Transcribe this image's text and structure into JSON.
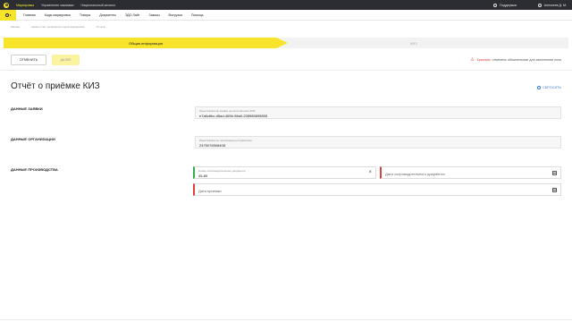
{
  "topbar": {
    "links": [
      "Маркировка",
      "Управление заказами",
      "Национальный каталог"
    ],
    "support": "Поддержка",
    "user": "Алексеев Д. М."
  },
  "subnav": {
    "items": [
      "Главная",
      "Коды маркировки",
      "Товары",
      "Документы",
      "ЭДО Лайт",
      "Заказы",
      "Выгрузки",
      "Помощь"
    ]
  },
  "breadcrumbs": [
    "Заказы",
    "Заказ-отчёт на эмиссию кодов маркировки",
    "Отчёты"
  ],
  "stepper": {
    "step1": "Общая информация",
    "step2": "КИЗ"
  },
  "actions": {
    "cancel": "ОТМЕНИТЬ",
    "next": "ДАЛЕЕ"
  },
  "required_note": {
    "red_word": "Красным",
    "text": "отмечены обязательные для заполнения поля"
  },
  "page": {
    "title": "Отчёт о приёмке КИЗ",
    "reset": "СБРОСИТЬ"
  },
  "sections": {
    "order": {
      "label": "ДАННЫЕ ЗАЯВКИ",
      "field_label": "Идентификатор заявки на изготовление КИЗ",
      "field_value": "e7a6c6bc-d5ad-465b-98a0-208985695855"
    },
    "organization": {
      "label": "ДАННЫЕ ОРГАНИЗАЦИИ",
      "field_label": "Идентификатор организации-отправителя",
      "field_value": "2475076508408"
    },
    "production": {
      "label": "ДАННЫЕ ПРОИЗВОДСТВА",
      "doc_number_label": "Номер сопроводительного документа",
      "doc_number_value": "45-89",
      "doc_date_placeholder": "Дата сопроводительного документа",
      "acceptance_date_placeholder": "Дата приемки"
    }
  },
  "colors": {
    "accent": "#f6e32a",
    "topbar": "#2b2d33",
    "required": "#e04040",
    "valid": "#2fb34a",
    "link": "#3a7bd5"
  }
}
